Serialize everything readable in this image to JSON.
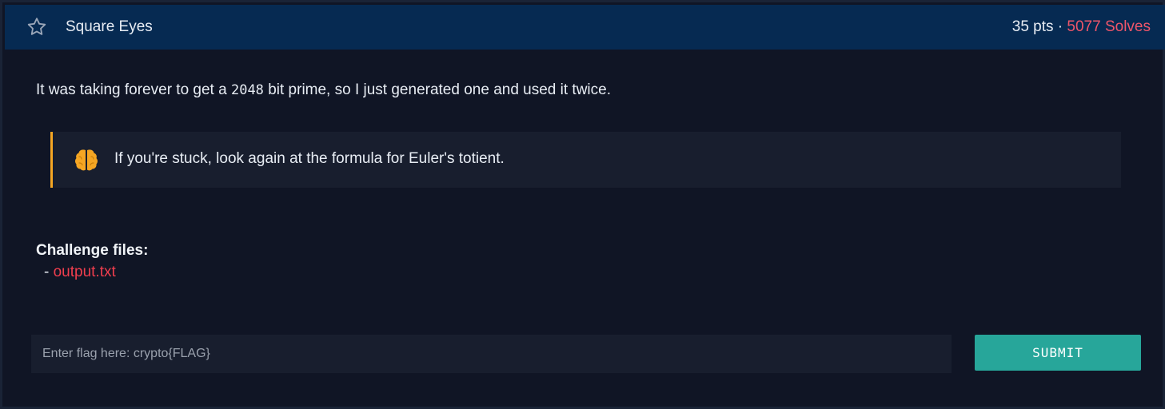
{
  "challenge": {
    "title": "Square Eyes",
    "points": "35 pts",
    "separator": " · ",
    "solves": "5077 Solves",
    "star_icon": "star-outline-icon"
  },
  "description": {
    "prefix": "It was taking forever to get a ",
    "number": "2048",
    "suffix": " bit prime, so I just generated one and used it twice."
  },
  "hint": {
    "icon": "brain-icon",
    "text": "If you're stuck, look again at the formula for Euler's totient."
  },
  "files": {
    "label": "Challenge files:",
    "bullet": "- ",
    "items": [
      {
        "name": "output.txt"
      }
    ]
  },
  "flag_form": {
    "placeholder": "Enter flag here: crypto{FLAG}",
    "value": "",
    "submit_label": "SUBMIT"
  },
  "colors": {
    "header_bg": "#062a52",
    "page_bg": "#101525",
    "accent_red": "#f03e4e",
    "hint_border": "#f5a623",
    "submit_bg": "#27a69a"
  }
}
